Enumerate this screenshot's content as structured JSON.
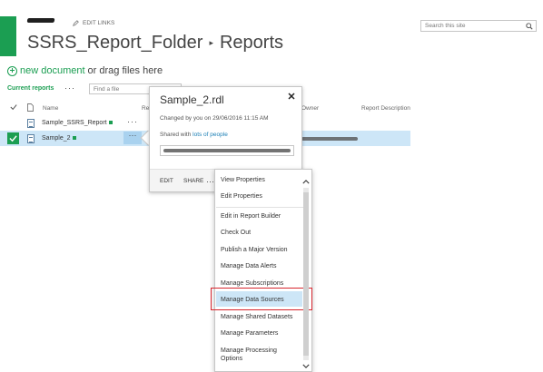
{
  "header": {
    "edit_links": "EDIT LINKS",
    "site_folder": "SSRS_Report_Folder",
    "separator": "▸",
    "page": "Reports",
    "search_placeholder": "Search this site"
  },
  "toolbar": {
    "new_document": "new document",
    "drag_text": "or drag files here",
    "current_view": "Current reports",
    "view_ellipsis": "···",
    "find_placeholder": "Find a file"
  },
  "columns": {
    "name": "Name",
    "modified_partial": "Re",
    "owner": "Owner",
    "report_description": "Report Description"
  },
  "rows": [
    {
      "name": "Sample_SSRS_Report",
      "ellipsis": "···"
    },
    {
      "name": "Sample_2",
      "ellipsis": "···"
    }
  ],
  "callout": {
    "title": "Sample_2.rdl",
    "changed_by": "Changed by you on 29/06/2016 11:15 AM",
    "shared_prefix": "Shared with ",
    "shared_link": "lots of people",
    "edit_label": "EDIT",
    "share_label": "SHARE",
    "more_label": "···"
  },
  "menu": {
    "items": [
      "View Properties",
      "Edit Properties",
      "Edit in Report Builder",
      "Check Out",
      "Publish a Major Version",
      "Manage Data Alerts",
      "Manage Subscriptions",
      "Manage Data Sources",
      "Manage Shared Datasets",
      "Manage Parameters",
      "Manage Processing Options"
    ],
    "highlighted": "Manage Data Sources"
  },
  "colors": {
    "brand_green": "#1b9e52",
    "selection_blue": "#cde6f7",
    "highlight_red": "#d7262e",
    "link_blue": "#1b7fb5"
  }
}
